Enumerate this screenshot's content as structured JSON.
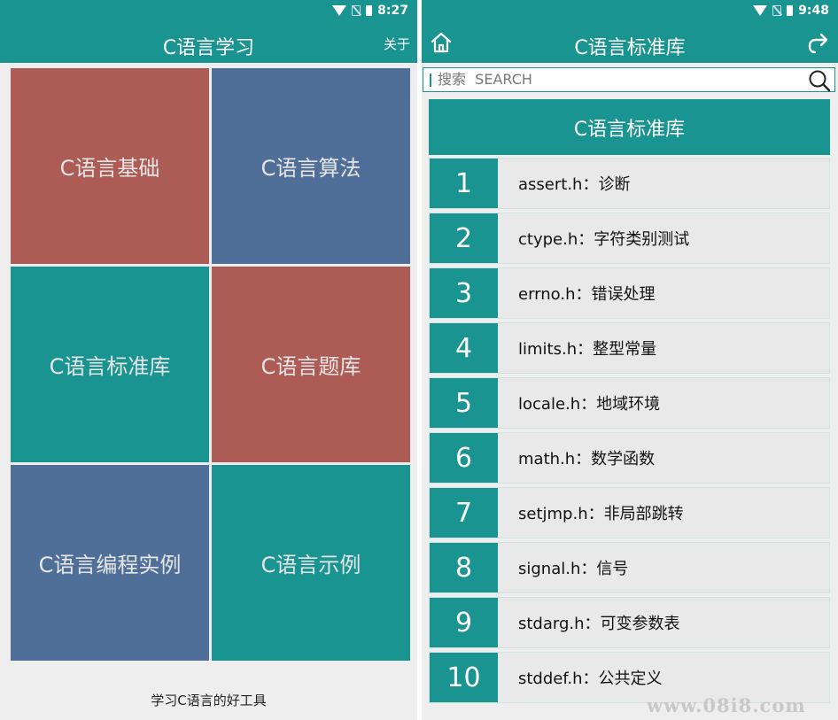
{
  "left": {
    "status": {
      "time": "8:27"
    },
    "appbar": {
      "title": "C语言学习",
      "about_label": "关于"
    },
    "tiles": [
      {
        "label": "C语言基础",
        "color": "#ad5b55"
      },
      {
        "label": "C语言算法",
        "color": "#4f6e98"
      },
      {
        "label": "C语言标准库",
        "color": "#1a9490"
      },
      {
        "label": "C语言题库",
        "color": "#ad5b55"
      },
      {
        "label": "C语言编程实例",
        "color": "#4f6e98"
      },
      {
        "label": "C语言示例",
        "color": "#1a9490"
      }
    ],
    "footer": "学习C语言的好工具"
  },
  "right": {
    "status": {
      "time": "9:48"
    },
    "appbar": {
      "title": "C语言标准库",
      "home_icon": "home-icon",
      "share_icon": "share-icon"
    },
    "search": {
      "placeholder": "搜索  SEARCH",
      "value": "",
      "icon": "search-icon"
    },
    "header": "C语言标准库",
    "items": [
      {
        "num": "1",
        "label": "assert.h：诊断"
      },
      {
        "num": "2",
        "label": "ctype.h：字符类别测试"
      },
      {
        "num": "3",
        "label": "errno.h：错误处理"
      },
      {
        "num": "4",
        "label": "limits.h：整型常量"
      },
      {
        "num": "5",
        "label": "locale.h：地域环境"
      },
      {
        "num": "6",
        "label": "math.h：数学函数"
      },
      {
        "num": "7",
        "label": "setjmp.h：非局部跳转"
      },
      {
        "num": "8",
        "label": "signal.h：信号"
      },
      {
        "num": "9",
        "label": "stdarg.h：可变参数表"
      },
      {
        "num": "10",
        "label": "stddef.h：公共定义"
      }
    ]
  },
  "watermark": "www.08i8.com",
  "colors": {
    "accent": "#1a9490",
    "red": "#ad5b55",
    "blue": "#4f6e98"
  }
}
